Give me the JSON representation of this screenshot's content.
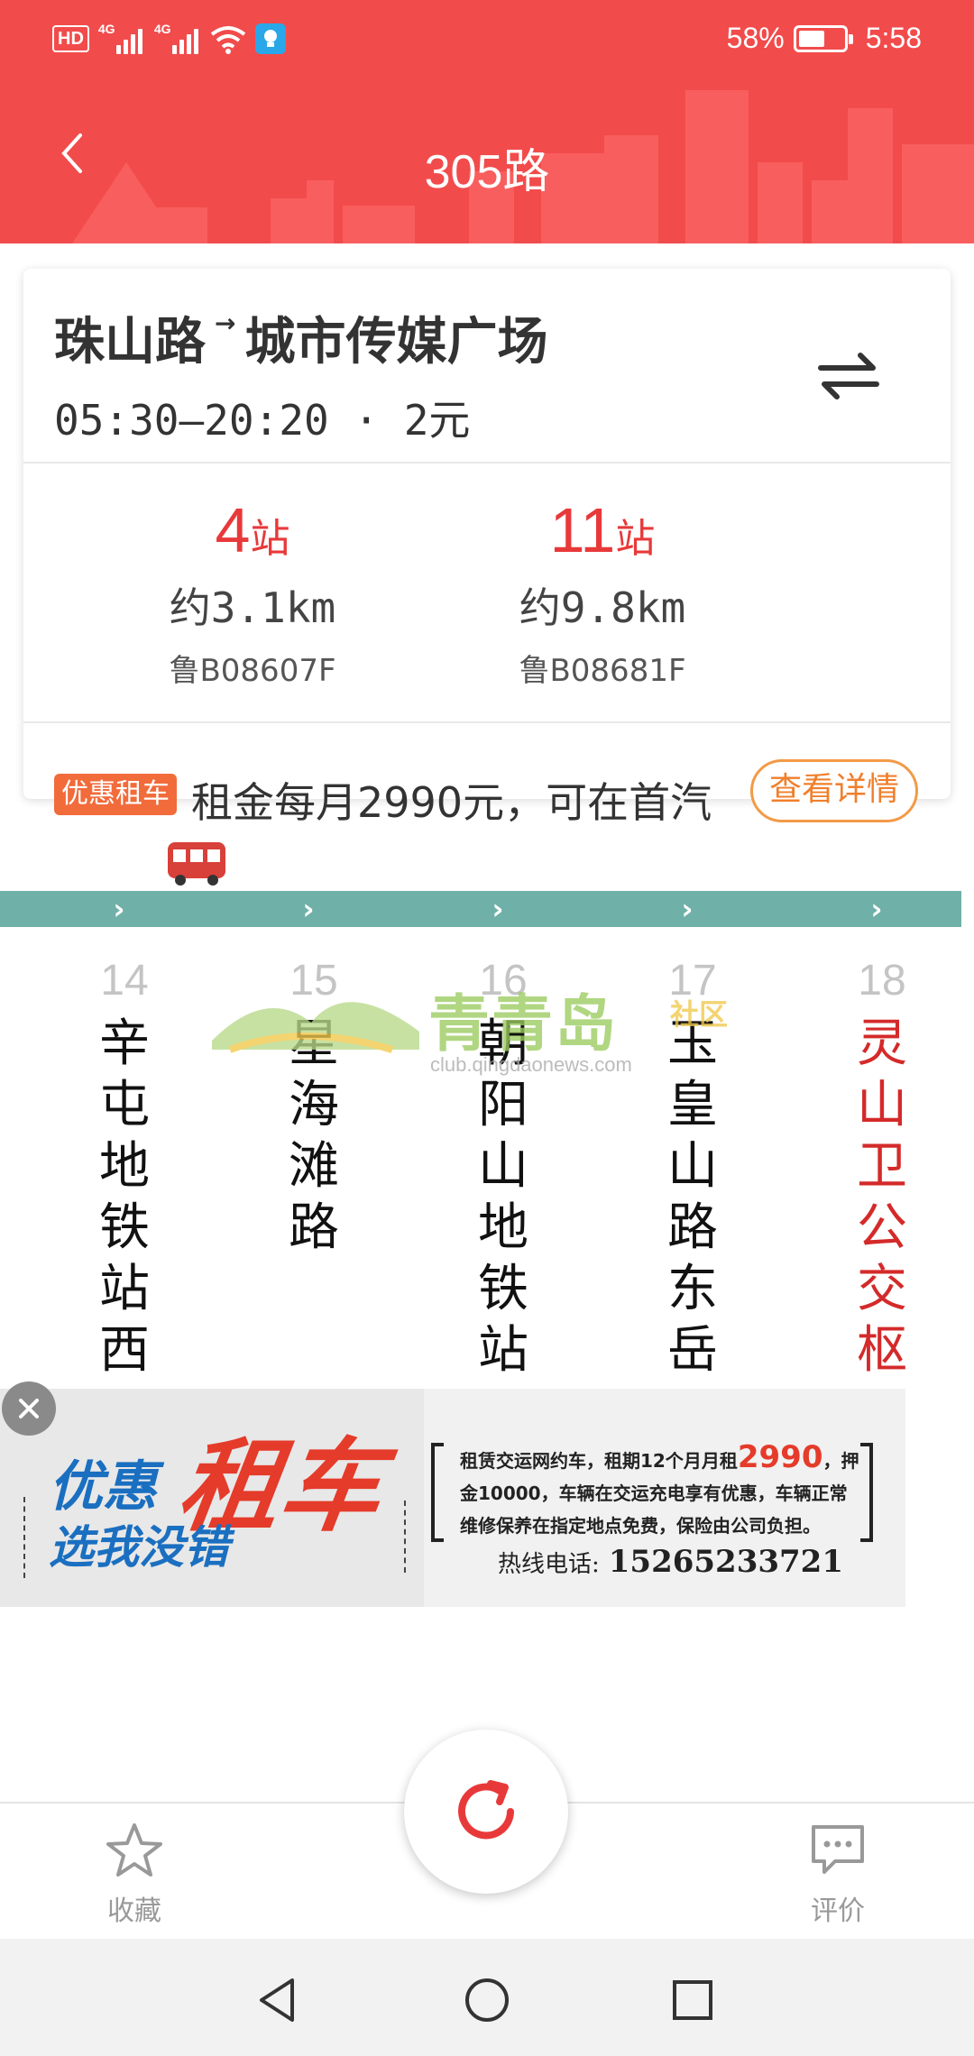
{
  "status_bar": {
    "hd_label": "HD",
    "signal_tag": "4G",
    "battery_percent_text": "58%",
    "battery_level": 0.58,
    "time": "5:58"
  },
  "header": {
    "title": "305路",
    "background_color": "#f24b4b"
  },
  "route": {
    "from": "珠山路",
    "arrow": "→",
    "to": "城市传媒广场",
    "hours_fare": "05:30—20:20 · 2元"
  },
  "buses": [
    {
      "stops": "4",
      "stops_unit": "站",
      "distance": "约3.1km",
      "plate": "鲁B08607F"
    },
    {
      "stops": "11",
      "stops_unit": "站",
      "distance": "约9.8km",
      "plate": "鲁B08681F"
    }
  ],
  "promo": {
    "tag": "优惠租车",
    "text": "租金每月2990元，可在首汽",
    "button": "查看详情"
  },
  "line_color": "#6fb0a8",
  "chevron": "›",
  "stations": [
    {
      "number": "14",
      "name": "辛屯地铁站西"
    },
    {
      "number": "15",
      "name": "星海滩路"
    },
    {
      "number": "16",
      "name": "朝阳山地铁站"
    },
    {
      "number": "17",
      "name": "玉皇山路东岳"
    },
    {
      "number": "18",
      "name": "灵山卫公交枢"
    }
  ],
  "watermark": {
    "title": "青青岛",
    "tag": "社区",
    "url": "club.qingdaonews.com"
  },
  "ad": {
    "headline_1": "优惠",
    "headline_2": "租车",
    "headline_3": "选我没错",
    "desc_1": "租赁交运网约车，租期12个月月租",
    "price": "2990",
    "desc_2": "，押金10000，车辆在交运充电享有优惠，车辆正常维修保养在指定地点免费，保险由公司负担。",
    "hotline_label": "热线电话:",
    "hotline_number": "15265233721"
  },
  "bottom_bar": {
    "favorite": "收藏",
    "review": "评价"
  },
  "colors": {
    "accent_red": "#e8393a",
    "promo_orange": "#f26b3a",
    "current_station": "#d42a2a"
  }
}
